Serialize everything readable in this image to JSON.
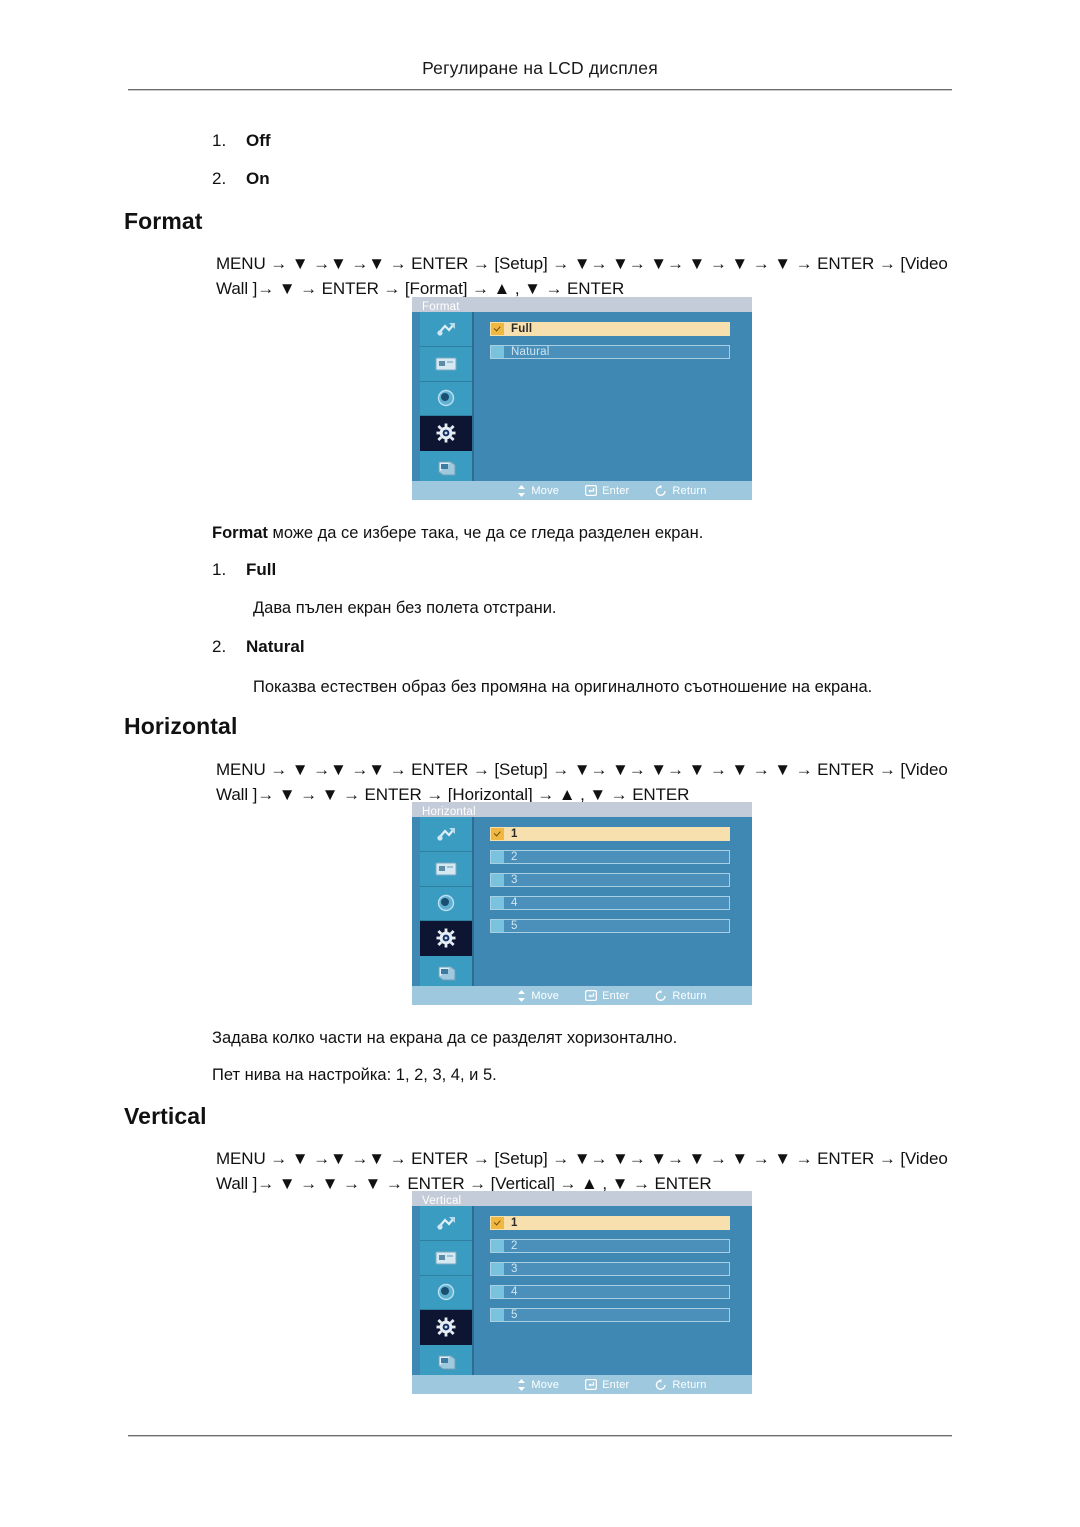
{
  "page": {
    "running_head": "Регулиране на LCD дисплея"
  },
  "top_list": [
    {
      "num": "1.",
      "label": "Off"
    },
    {
      "num": "2.",
      "label": "On"
    }
  ],
  "sections": [
    {
      "heading": "Format",
      "menu_path_line1": "MENU → ▼ →▼ →▼ → ENTER → [Setup] → ▼→ ▼→ ▼→ ▼ → ▼ → ▼ → ENTER → [Video",
      "menu_path_line2": "Wall ]→ ▼ → ENTER → [Format] → ▲ , ▼ → ENTER",
      "osd": {
        "title": "Format",
        "options": [
          {
            "label": "Full",
            "selected": true
          },
          {
            "label": "Natural",
            "selected": false
          }
        ]
      },
      "intro_bold": "Format",
      "intro_rest": " може да се избере така, че да се гледа разделен екран.",
      "items": [
        {
          "num": "1.",
          "label": "Full",
          "desc": "Дава пълен екран без полета отстрани."
        },
        {
          "num": "2.",
          "label": "Natural",
          "desc": "Показва естествен образ без промяна на оригиналното съотношение на екрана."
        }
      ]
    },
    {
      "heading": "Horizontal",
      "menu_path_line1": "MENU → ▼ →▼ →▼ → ENTER → [Setup] → ▼→ ▼→ ▼→ ▼ → ▼ → ▼ → ENTER → [Video",
      "menu_path_line2": "Wall ]→ ▼ → ▼ → ENTER → [Horizontal] → ▲ , ▼ → ENTER",
      "osd": {
        "title": "Horizontal",
        "options": [
          {
            "label": "1",
            "selected": true
          },
          {
            "label": "2",
            "selected": false
          },
          {
            "label": "3",
            "selected": false
          },
          {
            "label": "4",
            "selected": false
          },
          {
            "label": "5",
            "selected": false
          }
        ]
      },
      "desc_line1": "Задава колко части на екрана да се разделят хоризонтално.",
      "desc_line2": "Пет нива на настройка: 1, 2, 3, 4, и 5."
    },
    {
      "heading": "Vertical",
      "menu_path_line1": "MENU → ▼ →▼ →▼ → ENTER → [Setup] → ▼→ ▼→ ▼→ ▼ → ▼ → ▼ → ENTER → [Video",
      "menu_path_line2": "Wall ]→ ▼ → ▼ → ▼ → ENTER → [Vertical] → ▲ , ▼ → ENTER",
      "osd": {
        "title": "Vertical",
        "options": [
          {
            "label": "1",
            "selected": true
          },
          {
            "label": "2",
            "selected": false
          },
          {
            "label": "3",
            "selected": false
          },
          {
            "label": "4",
            "selected": false
          },
          {
            "label": "5",
            "selected": false
          }
        ]
      }
    }
  ],
  "osd_common": {
    "sidebar_icons": [
      "picture-brush-icon",
      "screen-monitor-icon",
      "audio-speaker-icon",
      "setup-gear-icon",
      "multi-control-icon"
    ],
    "selected_sidebar_index": 3,
    "status": [
      {
        "icon": "move-updown-icon",
        "label": "Move"
      },
      {
        "icon": "enter-key-icon",
        "label": "Enter"
      },
      {
        "icon": "return-arrow-icon",
        "label": "Return"
      }
    ]
  },
  "colors": {
    "osd_body": "#3f88b4",
    "osd_titlebar": "#c3ccd8",
    "osd_statusbar": "#9dc8dd",
    "osd_sidebar_cell": "#3a9cc0",
    "osd_sidebar_selected": "#0d1533",
    "osd_row_selected": "#f7dfae",
    "osd_checkbox": "#f0b840",
    "osd_box": "#79c3de"
  }
}
